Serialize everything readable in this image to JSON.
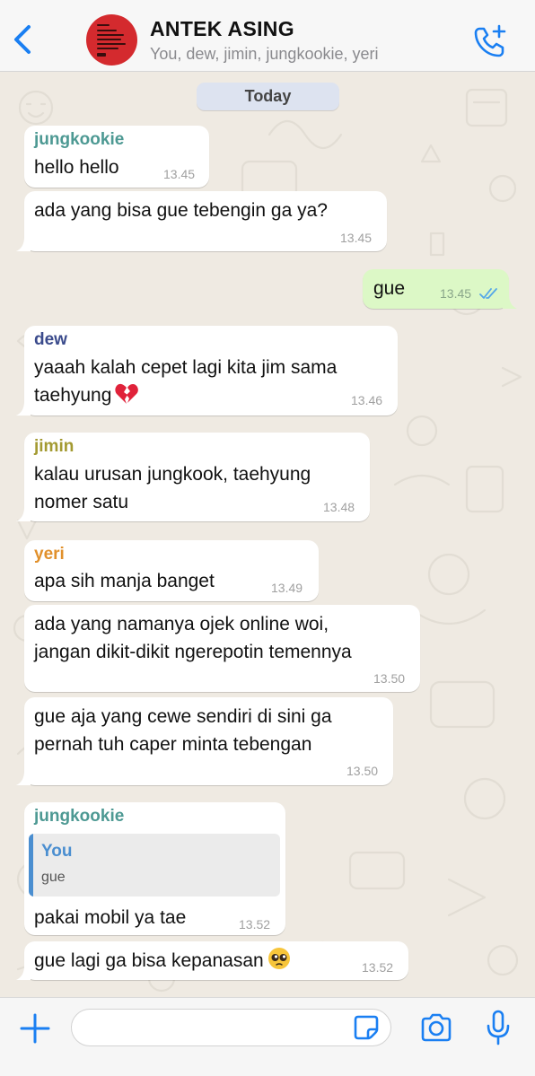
{
  "header": {
    "group_name": "ANTEK ASING",
    "members": "You, dew, jimin, jungkookie, yeri"
  },
  "date_label": "Today",
  "colors": {
    "accent": "#1a7ff2",
    "jungkookie": "#4d9993",
    "dew": "#3b4b8c",
    "jimin": "#a39a31",
    "yeri": "#e1902b",
    "outgoing_bubble": "#dcf8c6",
    "read_ticks": "#54a7e8"
  },
  "messages": [
    {
      "sender": "jungkookie",
      "lines": [
        "hello hello"
      ],
      "time": "13.45"
    },
    {
      "lines": [
        "ada yang bisa gue tebengin ga ya?"
      ],
      "time": "13.45"
    },
    {
      "lines": [
        "gue"
      ],
      "time": "13.45",
      "outgoing": true
    },
    {
      "sender": "dew",
      "lines": [
        "yaaah kalah cepet lagi kita jim sama",
        "taehyung"
      ],
      "time": "13.46",
      "emoji": "broken-heart"
    },
    {
      "sender": "jimin",
      "lines": [
        "kalau urusan jungkook, taehyung",
        "nomer satu"
      ],
      "time": "13.48"
    },
    {
      "sender": "yeri",
      "lines": [
        "apa sih manja banget"
      ],
      "time": "13.49"
    },
    {
      "lines": [
        "ada yang namanya ojek online woi,",
        "jangan dikit-dikit ngerepotin temennya"
      ],
      "time": "13.50"
    },
    {
      "lines": [
        "gue aja yang cewe sendiri di sini ga",
        "pernah tuh caper minta tebengan"
      ],
      "time": "13.50"
    },
    {
      "sender": "jungkookie",
      "quote": {
        "name": "You",
        "text": "gue"
      },
      "lines": [
        "pakai mobil ya tae"
      ],
      "time": "13.52"
    },
    {
      "lines": [
        "gue lagi ga bisa kepanasan"
      ],
      "time": "13.52",
      "emoji": "pleading-face"
    }
  ],
  "input": {
    "placeholder": ""
  },
  "icons": [
    "back-icon",
    "group-avatar",
    "add-call-icon",
    "plus-icon",
    "sticker-icon",
    "camera-icon",
    "microphone-icon",
    "broken-heart-emoji",
    "pleading-face-emoji",
    "read-ticks-icon"
  ]
}
